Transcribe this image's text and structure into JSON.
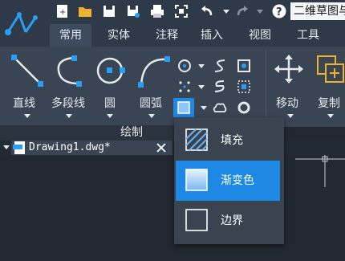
{
  "quick_access": {
    "doc_title": "二维草图与",
    "icons": [
      "new-file-icon",
      "open-folder-icon",
      "save-icon",
      "save-as-icon",
      "print-icon",
      "fit-icon",
      "undo-icon",
      "redo-icon",
      "help-icon"
    ]
  },
  "tabs": [
    "常用",
    "实体",
    "注释",
    "插入",
    "视图",
    "工具"
  ],
  "ribbon": {
    "tools": {
      "line": "直线",
      "polyline": "多段线",
      "circle": "圆",
      "arc": "圆弧",
      "move": "移动",
      "copy": "复制"
    },
    "panel_title": "绘制"
  },
  "document": {
    "tab_name": "Drawing1.dwg*"
  },
  "hatch_menu": {
    "items": [
      {
        "label": "填充",
        "selected": false
      },
      {
        "label": "渐变色",
        "selected": true
      },
      {
        "label": "边界",
        "selected": false
      }
    ]
  },
  "colors": {
    "accent": "#1e88e5",
    "ribbon": "#3a4554",
    "background": "#212830"
  }
}
